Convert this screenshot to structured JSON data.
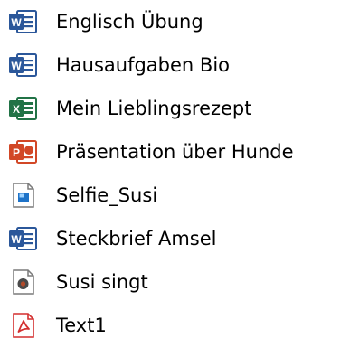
{
  "files": [
    {
      "name": "Englisch Übung",
      "icon": "word-document-icon",
      "accent": "#2b579a"
    },
    {
      "name": "Hausaufgaben Bio",
      "icon": "word-document-icon",
      "accent": "#2b579a"
    },
    {
      "name": "Mein Lieblingsrezept",
      "icon": "excel-spreadsheet-icon",
      "accent": "#217346"
    },
    {
      "name": "Präsentation über Hunde",
      "icon": "powerpoint-presentation-icon",
      "accent": "#d24726"
    },
    {
      "name": "Selfie_Susi",
      "icon": "image-file-icon",
      "accent": "#1e73c8"
    },
    {
      "name": "Steckbrief Amsel",
      "icon": "word-document-icon",
      "accent": "#2b579a"
    },
    {
      "name": "Susi singt",
      "icon": "audio-file-icon",
      "accent": "#b24a2a"
    },
    {
      "name": "Text1",
      "icon": "pdf-file-icon",
      "accent": "#d32f2f"
    }
  ]
}
